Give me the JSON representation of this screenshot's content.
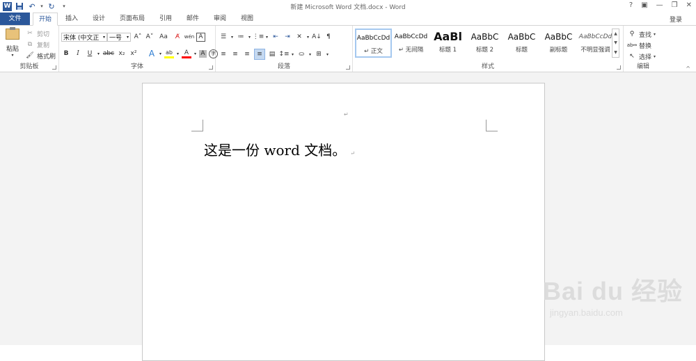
{
  "window": {
    "title": "新建 Microsoft Word 文档.docx - Word",
    "controls": [
      "?",
      "▣",
      "—",
      "❐",
      "✕"
    ],
    "login": "登录"
  },
  "qat": {
    "undo": "↶",
    "redo": "↻",
    "more": "▾"
  },
  "tabs": [
    {
      "label": "文件"
    },
    {
      "label": "开始"
    },
    {
      "label": "插入"
    },
    {
      "label": "设计"
    },
    {
      "label": "页面布局"
    },
    {
      "label": "引用"
    },
    {
      "label": "邮件"
    },
    {
      "label": "审阅"
    },
    {
      "label": "视图"
    }
  ],
  "clipboard": {
    "paste": "粘贴",
    "cut": "剪切",
    "copy": "复制",
    "format_painter": "格式刷",
    "label": "剪贴板"
  },
  "font": {
    "name": "宋体 (中文正",
    "size": "一号",
    "label": "字体",
    "grow": "A˄",
    "shrink": "A˅",
    "case": "Aa",
    "bold": "B",
    "italic": "I",
    "underline": "U",
    "strike": "abc",
    "sub": "x₂",
    "sup": "x²",
    "effects": "A",
    "highlight": "ab",
    "color": "A",
    "shade": "A",
    "enclose": "字"
  },
  "paragraph": {
    "label": "段落"
  },
  "styles": {
    "label": "样式",
    "items": [
      {
        "preview": "AaBbCcDd",
        "name": "↵ 正文"
      },
      {
        "preview": "AaBbCcDd",
        "name": "↵ 无间隔"
      },
      {
        "preview": "AaBl",
        "name": "标题 1"
      },
      {
        "preview": "AaBbC",
        "name": "标题 2"
      },
      {
        "preview": "AaBbC",
        "name": "标题"
      },
      {
        "preview": "AaBbC",
        "name": "副标题"
      },
      {
        "preview": "AaBbCcDd",
        "name": "不明显强调"
      }
    ]
  },
  "editing": {
    "label": "编辑",
    "find": "查找",
    "replace": "替换",
    "select": "选择"
  },
  "document": {
    "text": "这是一份 word 文档。",
    "para_mark": "↵"
  },
  "watermark": {
    "main": "Bai du 经验",
    "sub": "jingyan.baidu.com"
  },
  "colors": {
    "accent": "#2b579a",
    "highlight": "#ffff00",
    "font_color": "#ff0000"
  }
}
